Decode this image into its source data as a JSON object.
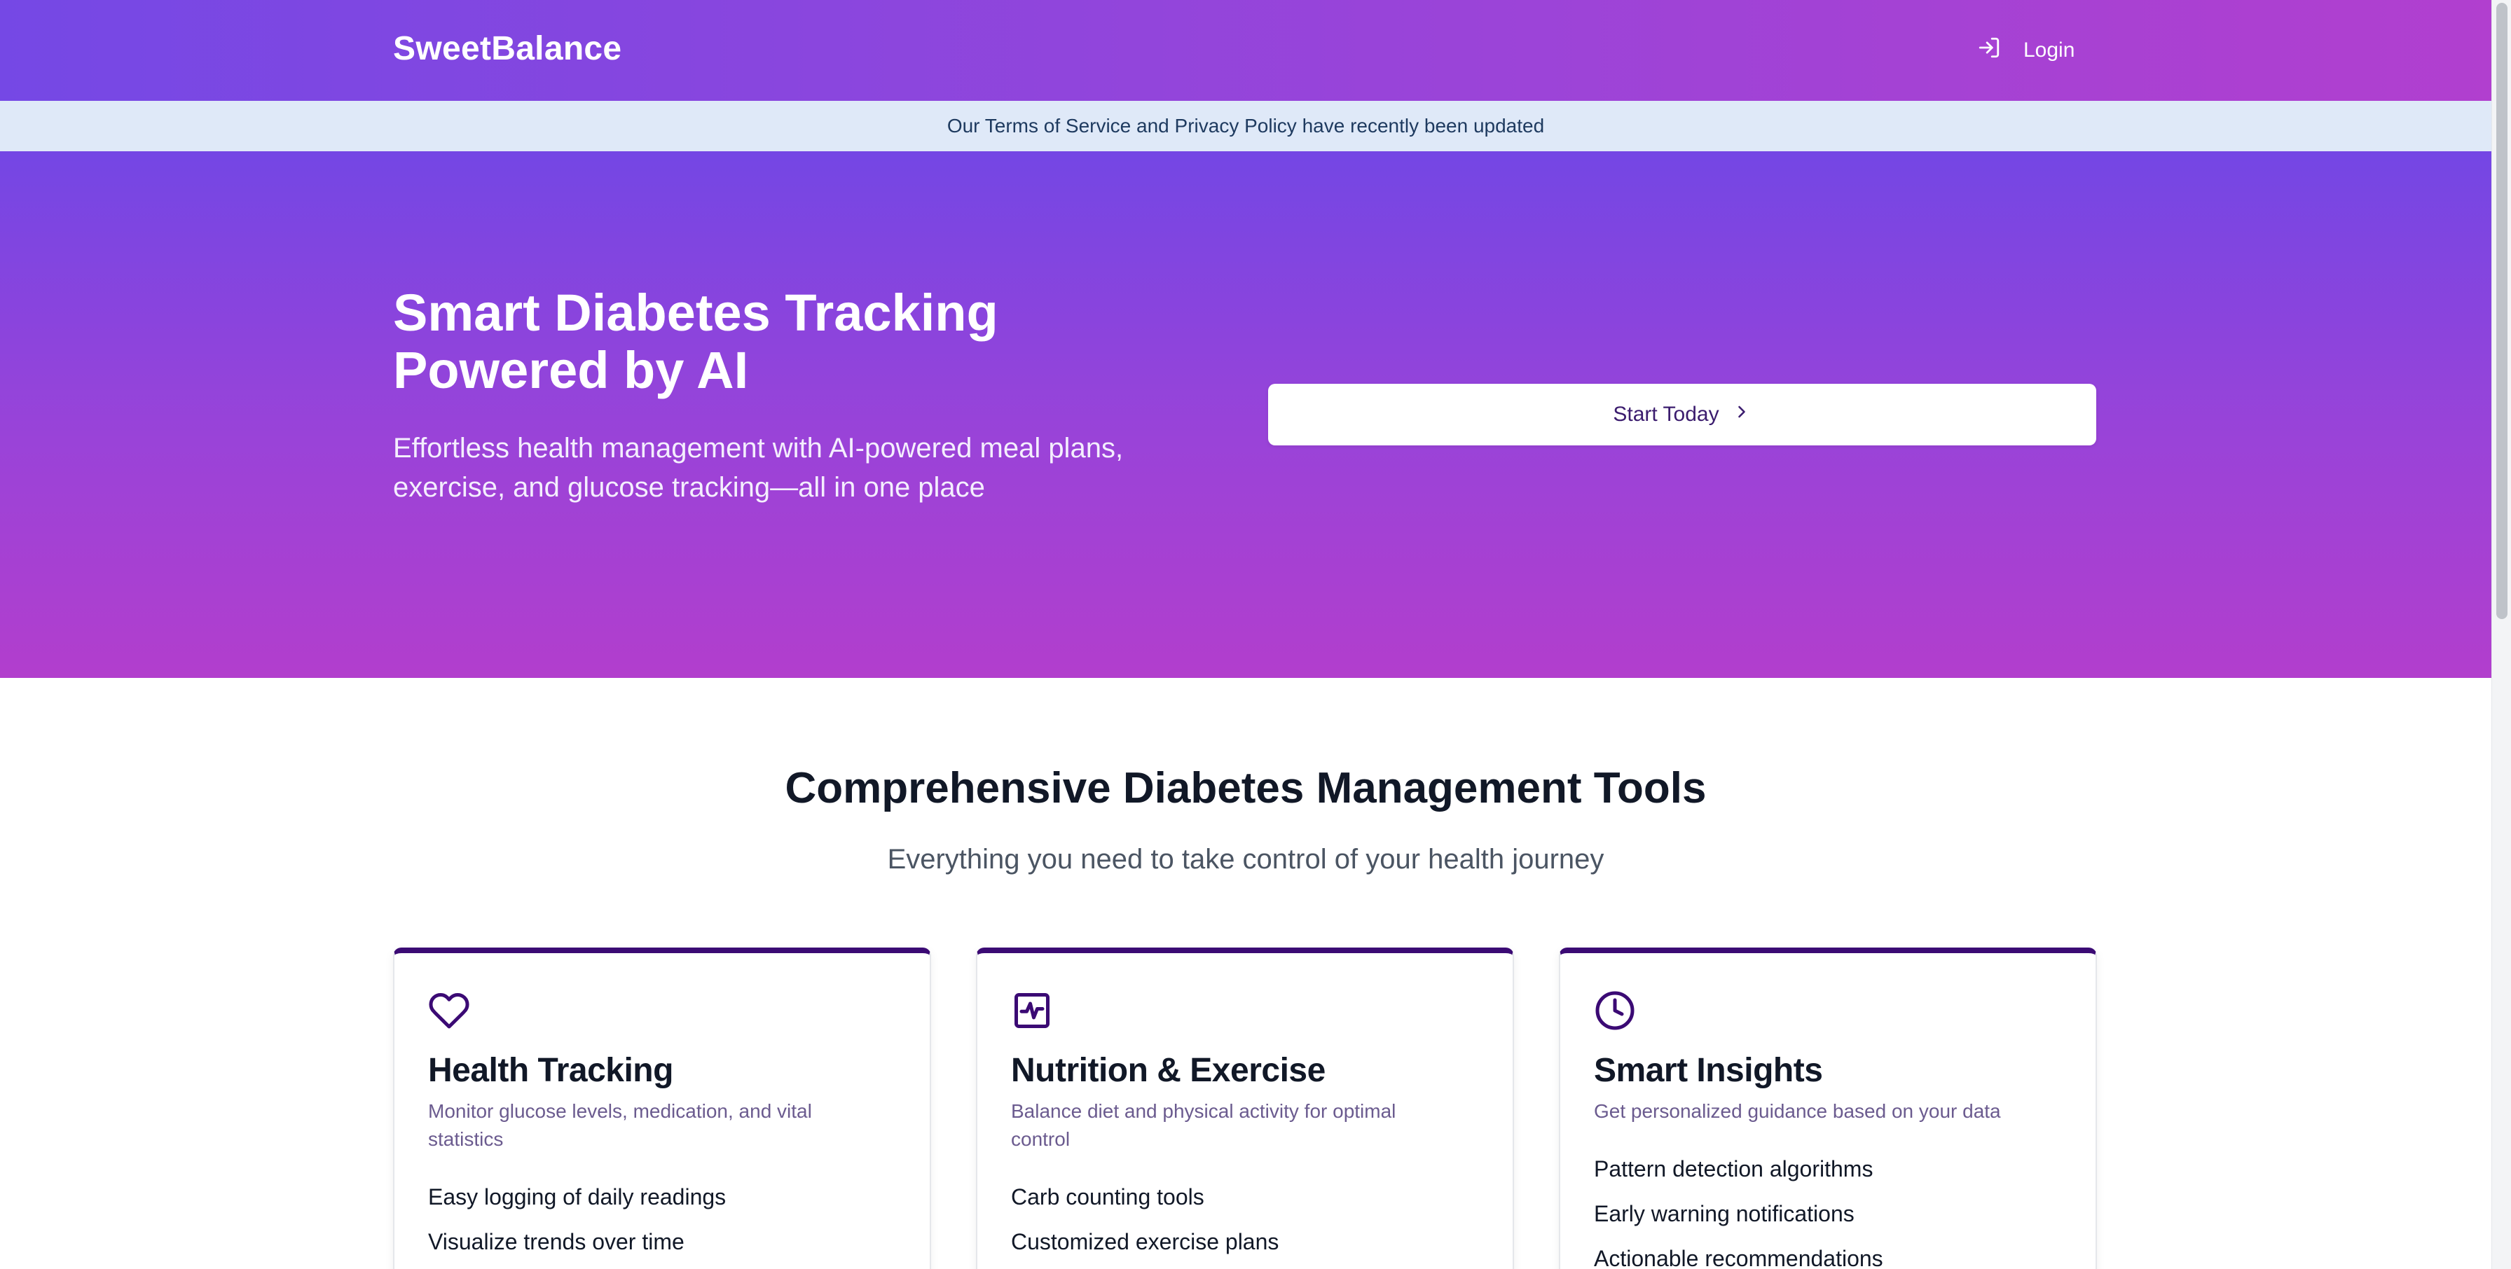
{
  "header": {
    "brand": "SweetBalance",
    "login_label": "Login",
    "login_icon": "login-icon"
  },
  "notice": {
    "text": "Our Terms of Service and Privacy Policy have recently been updated"
  },
  "hero": {
    "title": "Smart Diabetes Tracking Powered by AI",
    "subtitle": "Effortless health management with AI-powered meal plans, exercise, and glucose tracking—all in one place",
    "cta_label": "Start Today",
    "cta_icon": "chevron-right-icon"
  },
  "tools": {
    "title": "Comprehensive Diabetes Management Tools",
    "subtitle": "Everything you need to take control of your health journey",
    "cards": [
      {
        "icon": "heart-icon",
        "title": "Health Tracking",
        "description": "Monitor glucose levels, medication, and vital statistics",
        "items": [
          "Easy logging of daily readings",
          "Visualize trends over time"
        ]
      },
      {
        "icon": "activity-icon",
        "title": "Nutrition & Exercise",
        "description": "Balance diet and physical activity for optimal control",
        "items": [
          "Carb counting tools",
          "Customized exercise plans"
        ]
      },
      {
        "icon": "clock-icon",
        "title": "Smart Insights",
        "description": "Get personalized guidance based on your data",
        "items": [
          "Pattern detection algorithms",
          "Early warning notifications",
          "Actionable recommendations"
        ]
      }
    ]
  },
  "colors": {
    "gradient_start": "#7548e5",
    "gradient_end": "#b13fcf",
    "card_accent": "#3b0a74",
    "notice_bg": "#dfe9f8"
  }
}
